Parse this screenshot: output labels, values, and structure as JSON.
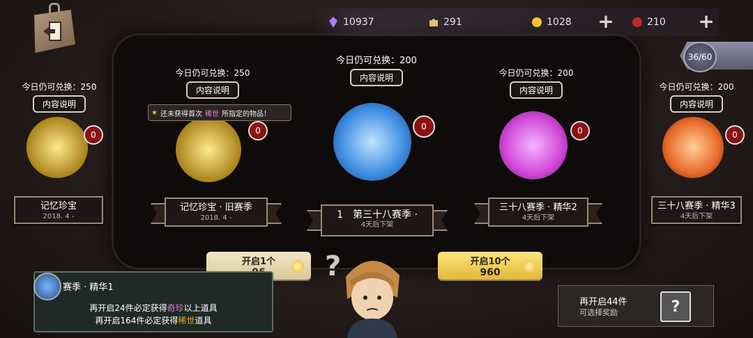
{
  "currencies": [
    {
      "name": "purple-crystal",
      "value": "10937",
      "color": "#b77cff"
    },
    {
      "name": "puzzle-piece",
      "value": "291",
      "color": "#e0c070"
    },
    {
      "name": "coin",
      "value": "1028",
      "color": "#f4c430"
    },
    {
      "name": "red-gem",
      "value": "210",
      "color": "#c0282c"
    }
  ],
  "progress": {
    "value": "36/60"
  },
  "tooltip": {
    "prefix": "还未获得首次",
    "highlight": "稀世",
    "suffix": "所指定的物品！"
  },
  "pools": [
    {
      "remain": "今日仍可兑换：250",
      "desc": "内容说明",
      "count": "0",
      "title": "记忆珍宝",
      "subtitle": "2018. 4 -",
      "orb_color": "#d4b24a"
    },
    {
      "remain": "今日仍可兑换：250",
      "desc": "内容说明",
      "count": "0",
      "title": "记忆珍宝 · 旧赛季",
      "subtitle": "2018. 4 -",
      "orb_color": "#d4b24a"
    },
    {
      "remain": "今日仍可兑换：200",
      "desc": "内容说明",
      "count": "0",
      "title": "第三十八赛季 ·",
      "title_prefix": "1",
      "subtitle": "4天后下架",
      "orb_color": "#3b8ce0"
    },
    {
      "remain": "今日仍可兑换：200",
      "desc": "内容说明",
      "count": "0",
      "title": "三十八赛季 · 精华2",
      "subtitle": "4天后下架",
      "orb_color": "#d046d8"
    },
    {
      "remain": "今日仍可兑换：200",
      "desc": "内容说明",
      "count": "0",
      "title": "三十八赛季 · 精华3",
      "subtitle": "4天后下架",
      "orb_color": "#e86a28"
    }
  ],
  "open_buttons": [
    {
      "label": "开启1个",
      "cost": "96"
    },
    {
      "label": "开启10个",
      "cost": "960"
    }
  ],
  "info_card": {
    "title": "赛季 · 精华1",
    "line1_pre": "再开启24件必定获得",
    "line1_hl": "奇珍",
    "line1_post": "以上道具",
    "line2_pre": "再开启164件必定获得",
    "line2_hl": "稀世",
    "line2_post": "道具"
  },
  "reward_card": {
    "line1": "再开启44件",
    "line2": "可选择奖励",
    "box": "?"
  }
}
